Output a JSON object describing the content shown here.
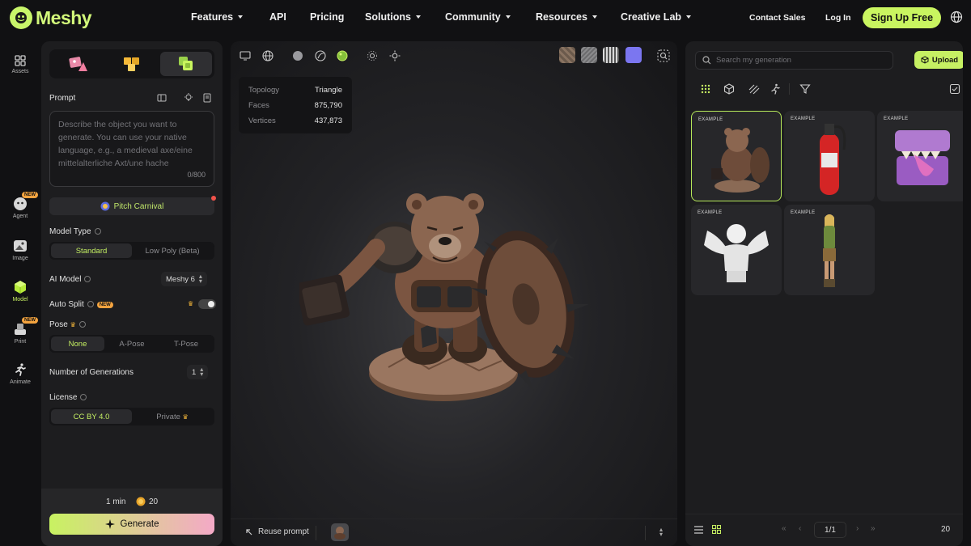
{
  "brand": {
    "name": "Meshy"
  },
  "nav": {
    "items": [
      {
        "label": "Features",
        "dropdown": true
      },
      {
        "label": "API",
        "dropdown": false
      },
      {
        "label": "Pricing",
        "dropdown": false
      },
      {
        "label": "Solutions",
        "dropdown": true
      },
      {
        "label": "Community",
        "dropdown": true
      },
      {
        "label": "Resources",
        "dropdown": true
      },
      {
        "label": "Creative Lab",
        "dropdown": true
      }
    ],
    "contact_sales": "Contact Sales",
    "login": "Log In",
    "signup": "Sign Up Free"
  },
  "rail": {
    "items": [
      {
        "label": "Assets",
        "icon": "grid-icon",
        "badge": ""
      },
      {
        "label": "Agent",
        "icon": "agent-icon",
        "badge": "NEW"
      },
      {
        "label": "Image",
        "icon": "image-icon",
        "badge": ""
      },
      {
        "label": "Model",
        "icon": "cube-icon",
        "badge": "",
        "active": true
      },
      {
        "label": "Print",
        "icon": "printer-icon",
        "badge": "NEW"
      },
      {
        "label": "Animate",
        "icon": "running-figure-icon",
        "badge": ""
      }
    ]
  },
  "left_panel": {
    "prompt_label": "Prompt",
    "prompt_placeholder": "Describe the object you want to generate. You can use your native language, e.g., a medieval axe/eine mittelalterliche Axt/une hache",
    "prompt_counter": "0/800",
    "pitch_label": "Pitch Carnival",
    "model_type": {
      "label": "Model Type",
      "options": [
        "Standard",
        "Low Poly (Beta)"
      ],
      "selected": "Standard"
    },
    "ai_model": {
      "label": "AI Model",
      "value": "Meshy 6"
    },
    "auto_split": {
      "label": "Auto Split",
      "badge": "NEW",
      "on": false
    },
    "pose": {
      "label": "Pose",
      "options": [
        "None",
        "A-Pose",
        "T-Pose"
      ],
      "selected": "None"
    },
    "generations": {
      "label": "Number of Generations",
      "value": "1"
    },
    "license": {
      "label": "License",
      "options": [
        "CC BY 4.0",
        "Private"
      ],
      "selected": "CC BY 4.0"
    },
    "footer": {
      "time": "1 min",
      "credits": "20",
      "generate": "Generate"
    }
  },
  "viewer": {
    "stats": [
      {
        "key": "Topology",
        "value": "Triangle"
      },
      {
        "key": "Faces",
        "value": "875,790"
      },
      {
        "key": "Vertices",
        "value": "437,873"
      }
    ],
    "reuse_prompt": "Reuse prompt",
    "swatch_colors": [
      "#6b5a4c",
      "#8a8a8c",
      "#d9d9d9",
      "#7b76f0"
    ]
  },
  "right_panel": {
    "search_placeholder": "Search my generation",
    "upload": "Upload",
    "cards": [
      {
        "tag": "EXAMPLE",
        "subject": "armored bear warrior",
        "selected": true
      },
      {
        "tag": "EXAMPLE",
        "subject": "fire extinguisher",
        "selected": false
      },
      {
        "tag": "EXAMPLE",
        "subject": "purple treasure chest monster",
        "selected": false
      },
      {
        "tag": "EXAMPLE",
        "subject": "angel bust statue",
        "selected": false
      },
      {
        "tag": "EXAMPLE",
        "subject": "elf archer figure",
        "selected": false
      }
    ],
    "page": "1/1",
    "per_page": "20"
  },
  "colors": {
    "accent": "#c9f560",
    "panel": "#1d1d1f",
    "background": "#111113"
  }
}
